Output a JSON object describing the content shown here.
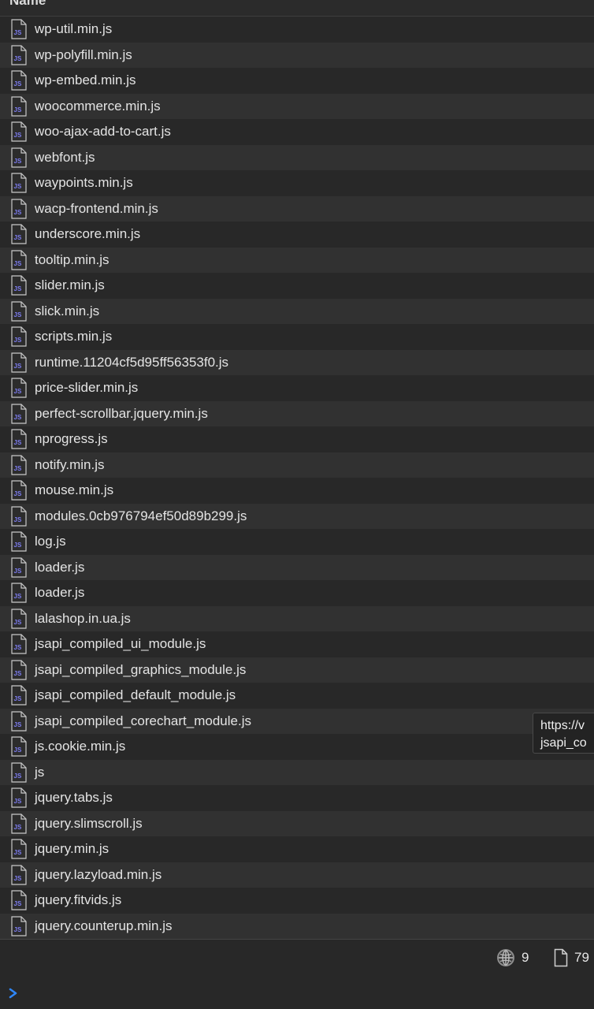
{
  "header": {
    "column_label": "Name"
  },
  "files": [
    {
      "name": "wp-util.min.js",
      "icon": "js-file-icon"
    },
    {
      "name": "wp-polyfill.min.js",
      "icon": "js-file-icon"
    },
    {
      "name": "wp-embed.min.js",
      "icon": "js-file-icon"
    },
    {
      "name": "woocommerce.min.js",
      "icon": "js-file-icon"
    },
    {
      "name": "woo-ajax-add-to-cart.js",
      "icon": "js-file-icon"
    },
    {
      "name": "webfont.js",
      "icon": "js-file-icon"
    },
    {
      "name": "waypoints.min.js",
      "icon": "js-file-icon"
    },
    {
      "name": "wacp-frontend.min.js",
      "icon": "js-file-icon"
    },
    {
      "name": "underscore.min.js",
      "icon": "js-file-icon"
    },
    {
      "name": "tooltip.min.js",
      "icon": "js-file-icon"
    },
    {
      "name": "slider.min.js",
      "icon": "js-file-icon"
    },
    {
      "name": "slick.min.js",
      "icon": "js-file-icon"
    },
    {
      "name": "scripts.min.js",
      "icon": "js-file-icon"
    },
    {
      "name": "runtime.11204cf5d95ff56353f0.js",
      "icon": "js-file-icon"
    },
    {
      "name": "price-slider.min.js",
      "icon": "js-file-icon"
    },
    {
      "name": "perfect-scrollbar.jquery.min.js",
      "icon": "js-file-icon"
    },
    {
      "name": "nprogress.js",
      "icon": "js-file-icon"
    },
    {
      "name": "notify.min.js",
      "icon": "js-file-icon"
    },
    {
      "name": "mouse.min.js",
      "icon": "js-file-icon"
    },
    {
      "name": "modules.0cb976794ef50d89b299.js",
      "icon": "js-file-icon"
    },
    {
      "name": "log.js",
      "icon": "js-file-icon"
    },
    {
      "name": "loader.js",
      "icon": "js-file-icon"
    },
    {
      "name": "loader.js",
      "icon": "js-file-icon"
    },
    {
      "name": "lalashop.in.ua.js",
      "icon": "js-file-icon"
    },
    {
      "name": "jsapi_compiled_ui_module.js",
      "icon": "js-file-icon"
    },
    {
      "name": "jsapi_compiled_graphics_module.js",
      "icon": "js-file-icon"
    },
    {
      "name": "jsapi_compiled_default_module.js",
      "icon": "js-file-icon"
    },
    {
      "name": "jsapi_compiled_corechart_module.js",
      "icon": "js-file-icon"
    },
    {
      "name": "js.cookie.min.js",
      "icon": "js-file-icon"
    },
    {
      "name": "js",
      "icon": "js-file-icon"
    },
    {
      "name": "jquery.tabs.js",
      "icon": "js-file-icon"
    },
    {
      "name": "jquery.slimscroll.js",
      "icon": "js-file-icon"
    },
    {
      "name": "jquery.min.js",
      "icon": "js-file-icon"
    },
    {
      "name": "jquery.lazyload.min.js",
      "icon": "js-file-icon"
    },
    {
      "name": "jquery.fitvids.js",
      "icon": "js-file-icon"
    },
    {
      "name": "jquery.counterup.min.js",
      "icon": "js-file-icon"
    }
  ],
  "tooltip": {
    "line1": "https://v",
    "line2": "jsapi_co"
  },
  "statusbar": {
    "requests_icon": "network-globe-icon",
    "requests_count": "9",
    "resources_icon": "document-icon",
    "resources_count": "79"
  },
  "console": {
    "prompt_icon": "chevron-right-icon"
  },
  "colors": {
    "background": "#282828",
    "row_alt": "#313131",
    "text": "#e4e4e4",
    "js_badge": "#7c7cf0",
    "prompt": "#2f86f7"
  }
}
